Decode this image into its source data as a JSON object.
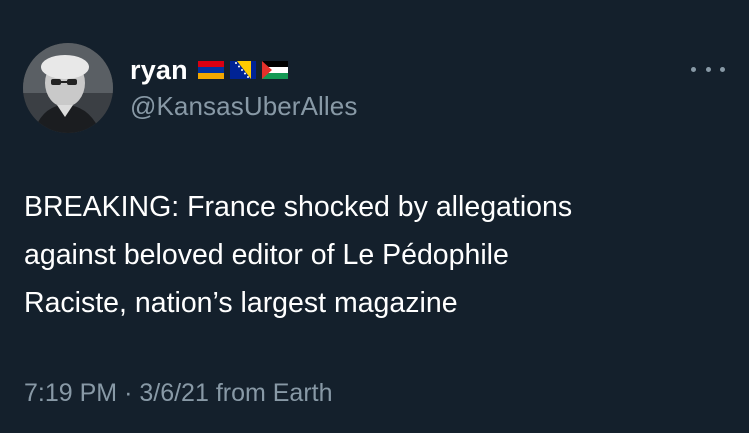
{
  "user": {
    "display_name": "ryan",
    "handle": "@KansasUberAlles",
    "flags": [
      "armenia-flag-icon",
      "bosnia-flag-icon",
      "palestine-flag-icon"
    ]
  },
  "tweet": {
    "lines": [
      "BREAKING: France shocked by allegations",
      "against beloved editor of Le Pédophile",
      "Raciste, nation’s largest magazine"
    ],
    "time": "7:19 PM",
    "separator": "·",
    "date": "3/6/21",
    "source": "from Earth"
  },
  "colors": {
    "background": "#14202c",
    "primary_text": "#ffffff",
    "secondary_text": "#8899a6"
  }
}
